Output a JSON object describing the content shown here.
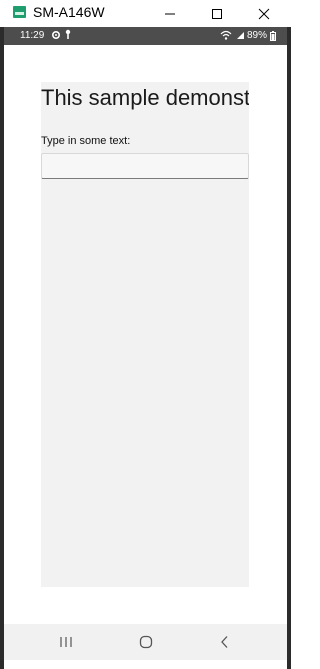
{
  "window": {
    "title": "SM-A146W",
    "app_icon": "scrcpy-icon"
  },
  "statusbar": {
    "time": "11:29",
    "battery": "89%",
    "icons": [
      "gear-icon",
      "key-icon",
      "wifi-icon",
      "signal-icon",
      "battery-icon"
    ]
  },
  "main": {
    "heading": "This sample demonst",
    "field_label": "Type in some text:",
    "input_value": ""
  },
  "navbar": {
    "buttons": [
      "recents-icon",
      "home-icon",
      "back-icon"
    ]
  },
  "colors": {
    "statusbar_bg": "#4d4d4d",
    "panel_bg": "#f2f2f2",
    "navbar_bg": "#f1f1f1",
    "app_icon": "#1e9e6e"
  }
}
